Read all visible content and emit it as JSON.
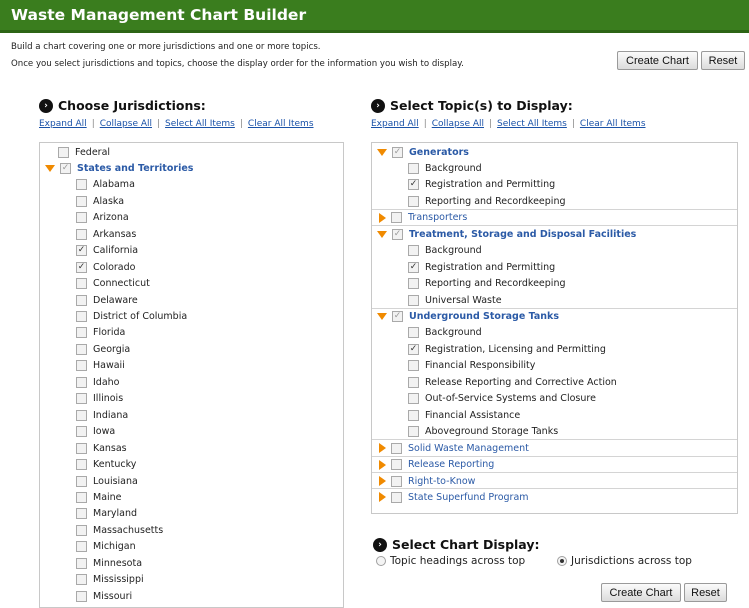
{
  "title": "Waste Management Chart Builder",
  "intro": {
    "line1": "Build a chart covering one or more jurisdictions and one or more topics.",
    "line2": "Once you select jurisdictions and topics, choose the display order for the information you wish to display."
  },
  "buttons": {
    "create": "Create Chart",
    "reset": "Reset"
  },
  "jurisdictions": {
    "heading": "Choose Jurisdictions:",
    "links": [
      "Expand All",
      "Collapse All",
      "Select All Items",
      "Clear All Items"
    ],
    "federal": "Federal",
    "group": {
      "label": "States and Territories",
      "checked": "partial"
    },
    "states": [
      {
        "name": "Alabama",
        "checked": false
      },
      {
        "name": "Alaska",
        "checked": false
      },
      {
        "name": "Arizona",
        "checked": false
      },
      {
        "name": "Arkansas",
        "checked": false
      },
      {
        "name": "California",
        "checked": true
      },
      {
        "name": "Colorado",
        "checked": true
      },
      {
        "name": "Connecticut",
        "checked": false
      },
      {
        "name": "Delaware",
        "checked": false
      },
      {
        "name": "District of Columbia",
        "checked": false
      },
      {
        "name": "Florida",
        "checked": false
      },
      {
        "name": "Georgia",
        "checked": false
      },
      {
        "name": "Hawaii",
        "checked": false
      },
      {
        "name": "Idaho",
        "checked": false
      },
      {
        "name": "Illinois",
        "checked": false
      },
      {
        "name": "Indiana",
        "checked": false
      },
      {
        "name": "Iowa",
        "checked": false
      },
      {
        "name": "Kansas",
        "checked": false
      },
      {
        "name": "Kentucky",
        "checked": false
      },
      {
        "name": "Louisiana",
        "checked": false
      },
      {
        "name": "Maine",
        "checked": false
      },
      {
        "name": "Maryland",
        "checked": false
      },
      {
        "name": "Massachusetts",
        "checked": false
      },
      {
        "name": "Michigan",
        "checked": false
      },
      {
        "name": "Minnesota",
        "checked": false
      },
      {
        "name": "Mississippi",
        "checked": false
      },
      {
        "name": "Missouri",
        "checked": false
      }
    ]
  },
  "topics": {
    "heading": "Select Topic(s) to Display:",
    "links": [
      "Expand All",
      "Collapse All",
      "Select All Items",
      "Clear All Items"
    ],
    "groups": [
      {
        "label": "Generators",
        "expanded": true,
        "checked": "partial",
        "items": [
          {
            "name": "Background",
            "checked": false
          },
          {
            "name": "Registration and Permitting",
            "checked": true
          },
          {
            "name": "Reporting and Recordkeeping",
            "checked": false
          }
        ]
      },
      {
        "label": "Transporters",
        "expanded": false,
        "checked": false,
        "items": []
      },
      {
        "label": "Treatment, Storage and Disposal Facilities",
        "expanded": true,
        "checked": "partial",
        "items": [
          {
            "name": "Background",
            "checked": false
          },
          {
            "name": "Registration and Permitting",
            "checked": true
          },
          {
            "name": "Reporting and Recordkeeping",
            "checked": false
          },
          {
            "name": "Universal Waste",
            "checked": false
          }
        ]
      },
      {
        "label": "Underground Storage Tanks",
        "expanded": true,
        "checked": "partial",
        "items": [
          {
            "name": "Background",
            "checked": false
          },
          {
            "name": "Registration, Licensing and Permitting",
            "checked": true
          },
          {
            "name": "Financial Responsibility",
            "checked": false
          },
          {
            "name": "Release Reporting and Corrective Action",
            "checked": false
          },
          {
            "name": "Out-of-Service Systems and Closure",
            "checked": false
          },
          {
            "name": "Financial Assistance",
            "checked": false
          },
          {
            "name": "Aboveground Storage Tanks",
            "checked": false
          }
        ]
      },
      {
        "label": "Solid Waste Management",
        "expanded": false,
        "checked": false,
        "items": []
      },
      {
        "label": "Release Reporting",
        "expanded": false,
        "checked": false,
        "items": []
      },
      {
        "label": "Right-to-Know",
        "expanded": false,
        "checked": false,
        "items": []
      },
      {
        "label": "State Superfund Program",
        "expanded": false,
        "checked": false,
        "items": []
      }
    ]
  },
  "display": {
    "heading": "Select Chart Display:",
    "options": [
      {
        "label": "Topic headings across top",
        "selected": false
      },
      {
        "label": "Jurisdictions across top",
        "selected": true
      }
    ]
  }
}
